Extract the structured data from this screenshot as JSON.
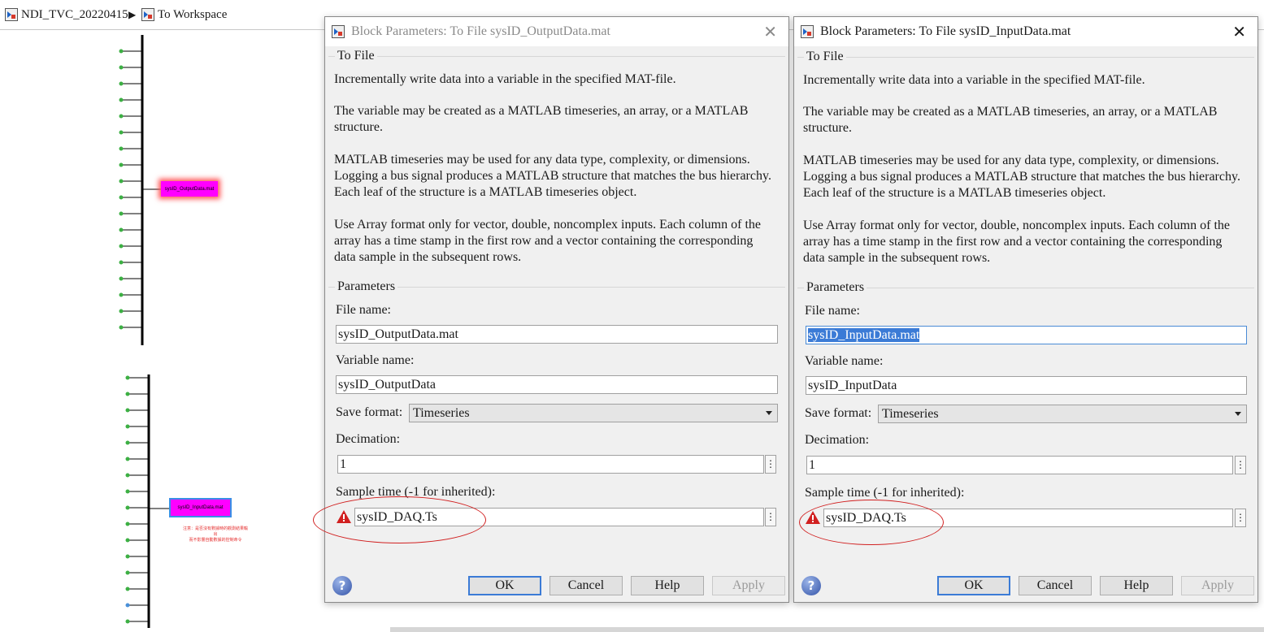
{
  "breadcrumb": {
    "root": "NDI_TVC_20220415",
    "separator": "▶",
    "current": "To Workspace"
  },
  "canvas": {
    "output_block": "sysID_OutputData.mat",
    "input_block": "sysID_InputData.mat",
    "note_line1": "注意：是否沒有數據時的觀測結果輸出",
    "note_line2": "而不影響自動數據的控制命令"
  },
  "dialogs": [
    {
      "title": "Block Parameters: To File sysID_OutputData.mat",
      "block_type": "To File",
      "desc1": "Incrementally write data into a variable in the specified MAT-file.",
      "desc2a": "The variable may be created as a MATLAB timeseries, an array, or a MATLAB",
      "desc2b": "structure.",
      "desc3a": "MATLAB timeseries may be used for any data type, complexity, or dimensions.",
      "desc3b": "Logging a bus signal produces a MATLAB structure that matches the bus hierarchy.",
      "desc3c": "Each leaf of the structure is a MATLAB timeseries object.",
      "desc4a": "Use Array format only for vector, double, noncomplex inputs. Each column of the",
      "desc4b": "array has a time stamp in the first row and a vector containing the corresponding",
      "desc4c": "data sample in the subsequent rows.",
      "params_label": "Parameters",
      "file_name_label": "File name:",
      "file_name": "sysID_OutputData.mat",
      "variable_name_label": "Variable name:",
      "variable_name": "sysID_OutputData",
      "save_format_label": "Save format:",
      "save_format": "Timeseries",
      "decimation_label": "Decimation:",
      "decimation": "1",
      "sample_time_label": "Sample time (-1 for inherited):",
      "sample_time": "sysID_DAQ.Ts",
      "ok": "OK",
      "cancel": "Cancel",
      "help": "Help",
      "apply": "Apply"
    },
    {
      "title": "Block Parameters: To File sysID_InputData.mat",
      "block_type": "To File",
      "desc1": "Incrementally write data into a variable in the specified MAT-file.",
      "desc2a": "The variable may be created as a MATLAB timeseries, an array, or a MATLAB",
      "desc2b": "structure.",
      "desc3a": "MATLAB timeseries may be used for any data type, complexity, or dimensions.",
      "desc3b": "Logging a bus signal produces a MATLAB structure that matches the bus hierarchy.",
      "desc3c": "Each leaf of the structure is a MATLAB timeseries object.",
      "desc4a": "Use Array format only for vector, double, noncomplex inputs. Each column of the",
      "desc4b": "array has a time stamp in the first row and a vector containing the corresponding",
      "desc4c": "data sample in the subsequent rows.",
      "params_label": "Parameters",
      "file_name_label": "File name:",
      "file_name": "sysID_InputData.mat",
      "variable_name_label": "Variable name:",
      "variable_name": "sysID_InputData",
      "save_format_label": "Save format:",
      "save_format": "Timeseries",
      "decimation_label": "Decimation:",
      "decimation": "1",
      "sample_time_label": "Sample time (-1 for inherited):",
      "sample_time": "sysID_DAQ.Ts",
      "ok": "OK",
      "cancel": "Cancel",
      "help": "Help",
      "apply": "Apply"
    }
  ],
  "colors": {
    "signal_port": "#3cb043",
    "block_fill": "#ff00ff",
    "warning": "#d12020",
    "annotation_ellipse": "#d12020",
    "focus": "#3b7bd6"
  },
  "icons": {
    "model": "simulink-model-icon",
    "warning": "warning-triangle-icon",
    "help": "help-icon",
    "close": "close-icon",
    "more": "vertical-ellipsis-icon"
  }
}
